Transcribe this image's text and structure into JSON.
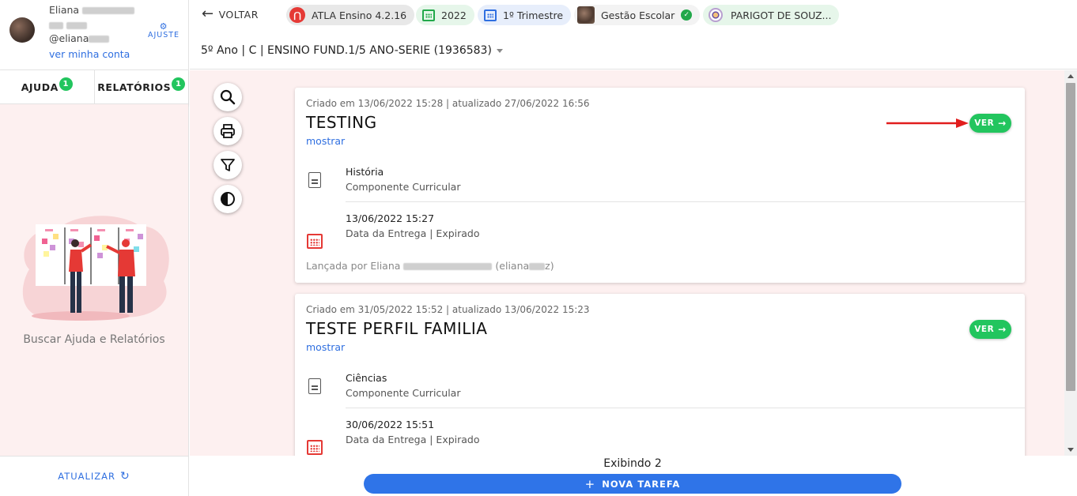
{
  "user": {
    "name": "Eliana",
    "handle": "@eliana",
    "account_link": "ver minha conta",
    "settings_label": "AJUSTE"
  },
  "sidebar": {
    "tabs": [
      {
        "label": "AJUDA",
        "badge": "1"
      },
      {
        "label": "RELATÓRIOS",
        "badge": "1"
      }
    ],
    "help_text": "Buscar Ajuda e Relatórios",
    "refresh_label": "ATUALIZAR"
  },
  "header": {
    "back_label": "VOLTAR",
    "chips": {
      "system": "ATLA Ensino 4.2.16",
      "year": "2022",
      "period": "1º Trimestre",
      "module": "Gestão Escolar",
      "school": "PARIGOT DE SOUZ..."
    },
    "class_selector": "5º Ano | C | ENSINO FUND.1/5 ANO-SERIE (1936583)"
  },
  "tasks": [
    {
      "meta": "Criado em 13/06/2022 15:28 | atualizado 27/06/2022 16:56",
      "title": "TESTING",
      "show_link": "mostrar",
      "action": "VER",
      "subject": "História",
      "subject_caption": "Componente Curricular",
      "due": "13/06/2022 15:27",
      "due_caption": "Data da Entrega | Expirado",
      "posted_by": "Lançada por Eliana",
      "posted_by_handle": "(eliana",
      "posted_by_close": "z)"
    },
    {
      "meta": "Criado em 31/05/2022 15:52 | atualizado 13/06/2022 15:23",
      "title": "TESTE PERFIL FAMILIA",
      "show_link": "mostrar",
      "action": "VER",
      "subject": "Ciências",
      "subject_caption": "Componente Curricular",
      "due": "30/06/2022 15:51",
      "due_caption": "Data da Entrega | Expirado"
    }
  ],
  "footer": {
    "count_text": "Exibindo 2",
    "new_task_label": "NOVA TAREFA"
  },
  "colors": {
    "accent_blue": "#2f74e8",
    "success_green": "#22c55e",
    "danger_red": "#e53935",
    "panel_pink": "#fdf0f0"
  },
  "icons": {
    "search": "search-icon",
    "print": "print-icon",
    "filter": "filter-icon",
    "contrast": "contrast-icon"
  }
}
